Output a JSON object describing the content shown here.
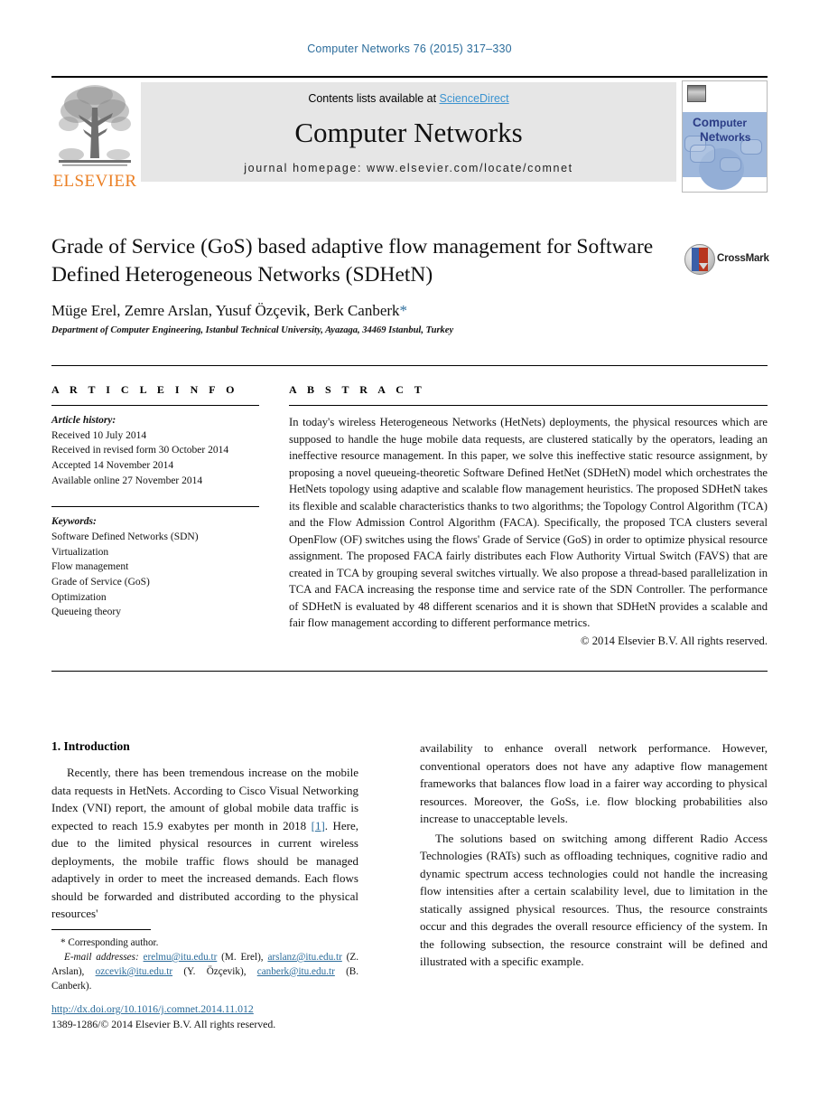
{
  "running_head": "Computer Networks 76 (2015) 317–330",
  "masthead": {
    "contents_prefix": "Contents lists available at ",
    "sciencedirect": "ScienceDirect",
    "journal_title": "Computer Networks",
    "homepage": "journal homepage: www.elsevier.com/locate/comnet",
    "publisher_logo_text": "ELSEVIER",
    "cover": {
      "line1_a": "Com",
      "line1_b": "puter",
      "line2_a": "Net",
      "line2_b": "works"
    },
    "accent_link_color": "#3b93d0",
    "elsevier_orange": "#eb7f23"
  },
  "article": {
    "title": "Grade of Service (GoS) based adaptive flow management for Software Defined Heterogeneous Networks (SDHetN)",
    "authors": "Müge Erel, Zemre Arslan, Yusuf Özçevik, Berk Canberk",
    "corresponding_marker": "*",
    "affiliation": "Department of Computer Engineering, Istanbul Technical University, Ayazaga, 34469 Istanbul, Turkey",
    "crossmark_label": "CrossMark"
  },
  "article_info": {
    "heading": "A R T I C L E  I N F O",
    "history_label": "Article history:",
    "history": [
      "Received 10 July 2014",
      "Received in revised form 30 October 2014",
      "Accepted 14 November 2014",
      "Available online 27 November 2014"
    ],
    "keywords_label": "Keywords:",
    "keywords": [
      "Software Defined Networks (SDN)",
      "Virtualization",
      "Flow management",
      "Grade of Service (GoS)",
      "Optimization",
      "Queueing theory"
    ]
  },
  "abstract": {
    "heading": "A B S T R A C T",
    "text": "In today's wireless Heterogeneous Networks (HetNets) deployments, the physical resources which are supposed to handle the huge mobile data requests, are clustered statically by the operators, leading an ineffective resource management. In this paper, we solve this ineffective static resource assignment, by proposing a novel queueing-theoretic Software Defined HetNet (SDHetN) model which orchestrates the HetNets topology using adaptive and scalable flow management heuristics. The proposed SDHetN takes its flexible and scalable characteristics thanks to two algorithms; the Topology Control Algorithm (TCA) and the Flow Admission Control Algorithm (FACA). Specifically, the proposed TCA clusters several OpenFlow (OF) switches using the flows' Grade of Service (GoS) in order to optimize physical resource assignment. The proposed FACA fairly distributes each Flow Authority Virtual Switch (FAVS) that are created in TCA by grouping several switches virtually. We also propose a thread-based parallelization in TCA and FACA increasing the response time and service rate of the SDN Controller. The performance of SDHetN is evaluated by 48 different scenarios and it is shown that SDHetN provides a scalable and fair flow management according to different performance metrics.",
    "copyright": "© 2014 Elsevier B.V. All rights reserved."
  },
  "body": {
    "section_heading": "1. Introduction",
    "left_paragraphs": [
      {
        "pre": "Recently, there has been tremendous increase on the mobile data requests in HetNets. According to Cisco Visual Networking Index (VNI) report, the amount of global mobile data traffic is expected to reach 15.9 exabytes per month in 2018 ",
        "ref": "[1]",
        "post": ". Here, due to the limited physical resources in current wireless deployments, the mobile traffic flows should be managed adaptively in order to meet the increased demands. Each flows should be forwarded and distributed according to the physical resources'"
      }
    ],
    "right_paragraphs": [
      "availability to enhance overall network performance. However, conventional operators does not have any adaptive flow management frameworks that balances flow load in a fairer way according to physical resources. Moreover, the GoSs, i.e. flow blocking probabilities also increase to unacceptable levels.",
      "The solutions based on switching among different Radio Access Technologies (RATs) such as offloading techniques, cognitive radio and dynamic spectrum access technologies could not handle the increasing flow intensities after a certain scalability level, due to limitation in the statically assigned physical resources. Thus, the resource constraints occur and this degrades the overall resource efficiency of the system. In the following subsection, the resource constraint will be defined and illustrated with a specific example."
    ]
  },
  "footnote": {
    "corresponding": "* Corresponding author.",
    "email_label": "E-mail addresses:",
    "emails": [
      {
        "address": "erelmu@itu.edu.tr",
        "name": "(M. Erel),"
      },
      {
        "address": "arslanz@itu.edu.tr",
        "name": "(Z. Arslan),"
      },
      {
        "address": "ozcevik@itu.edu.tr",
        "name": "(Y. Özçevik),"
      },
      {
        "address": "canberk@itu.edu.tr",
        "name": "(B. Canberk)."
      }
    ]
  },
  "doi": {
    "url": "http://dx.doi.org/10.1016/j.comnet.2014.11.012",
    "issn_line": "1389-1286/© 2014 Elsevier B.V. All rights reserved."
  }
}
